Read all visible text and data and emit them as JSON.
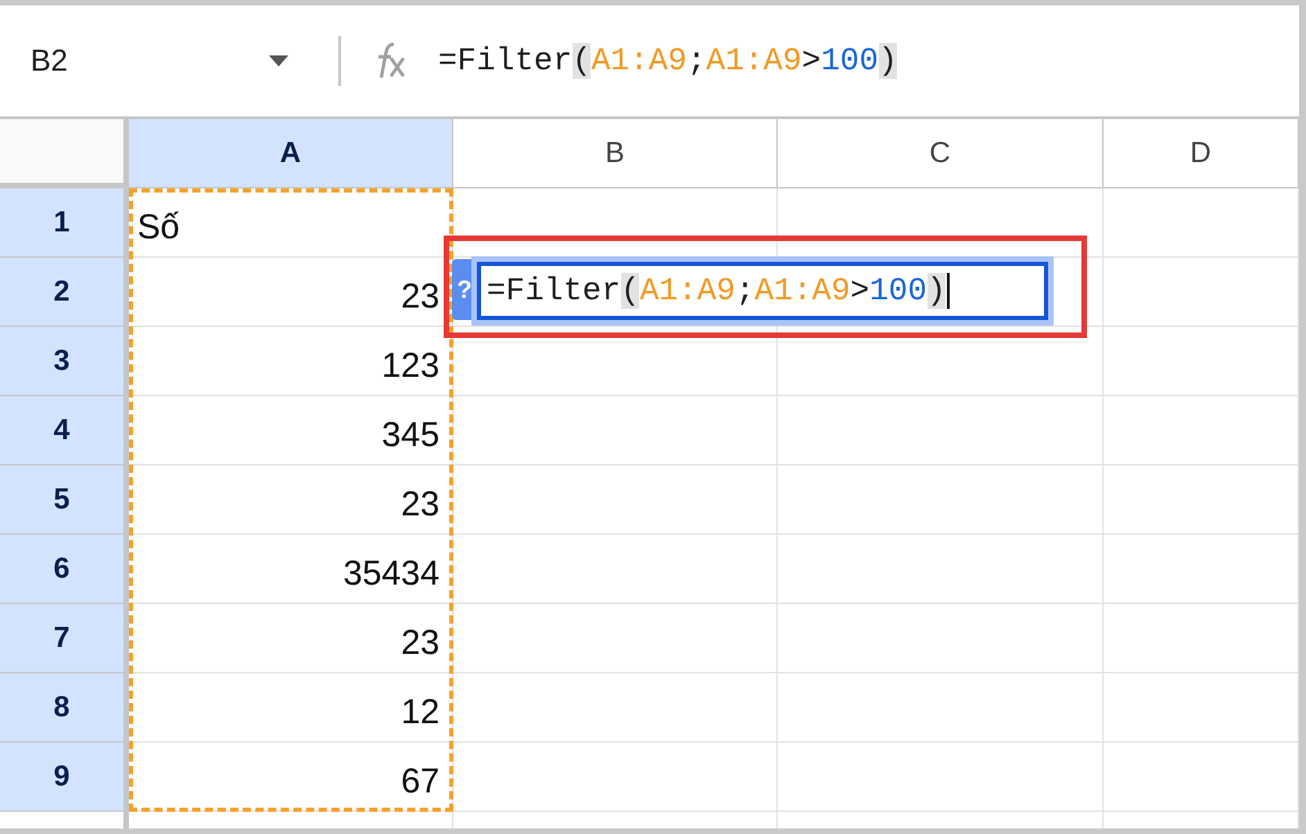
{
  "name_box": {
    "value": "B2"
  },
  "formula_bar": {
    "tokens": [
      {
        "text": "=Filter",
        "kind": "plain"
      },
      {
        "text": "(",
        "kind": "paren"
      },
      {
        "text": "A1:A9",
        "kind": "range"
      },
      {
        "text": ";",
        "kind": "plain"
      },
      {
        "text": "A1:A9",
        "kind": "range"
      },
      {
        "text": ">",
        "kind": "plain"
      },
      {
        "text": "100",
        "kind": "number"
      },
      {
        "text": ")",
        "kind": "paren"
      }
    ]
  },
  "columns": [
    {
      "label": "A",
      "selected": true
    },
    {
      "label": "B",
      "selected": false
    },
    {
      "label": "C",
      "selected": false
    },
    {
      "label": "D",
      "selected": false
    }
  ],
  "rows": [
    {
      "label": "1",
      "selected": true,
      "value": "Số",
      "kind": "text"
    },
    {
      "label": "2",
      "selected": true,
      "value": "23",
      "kind": "number"
    },
    {
      "label": "3",
      "selected": true,
      "value": "123",
      "kind": "number"
    },
    {
      "label": "4",
      "selected": true,
      "value": "345",
      "kind": "number"
    },
    {
      "label": "5",
      "selected": true,
      "value": "23",
      "kind": "number"
    },
    {
      "label": "6",
      "selected": true,
      "value": "35434",
      "kind": "number"
    },
    {
      "label": "7",
      "selected": true,
      "value": "23",
      "kind": "number"
    },
    {
      "label": "8",
      "selected": true,
      "value": "12",
      "kind": "number"
    },
    {
      "label": "9",
      "selected": true,
      "value": "67",
      "kind": "number"
    }
  ],
  "cell_editor": {
    "hint": "?",
    "tokens": [
      {
        "text": "=Filter",
        "kind": "plain"
      },
      {
        "text": "(",
        "kind": "paren"
      },
      {
        "text": "A1:A9",
        "kind": "range"
      },
      {
        "text": ";",
        "kind": "plain"
      },
      {
        "text": "A1:A9",
        "kind": "range"
      },
      {
        "text": ">",
        "kind": "plain"
      },
      {
        "text": "100",
        "kind": "number"
      },
      {
        "text": ")",
        "kind": "paren"
      }
    ]
  }
}
